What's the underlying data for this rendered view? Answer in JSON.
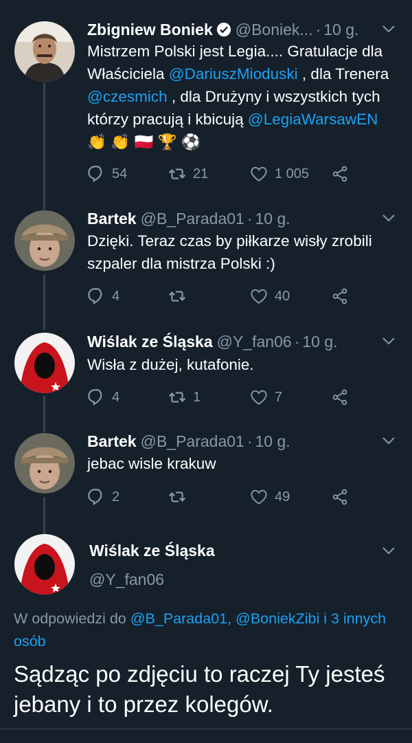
{
  "tweets": [
    {
      "name": "Zbigniew Boniek",
      "handle": "@Boniek...",
      "time": "10 g.",
      "verified": true,
      "text_parts": [
        {
          "t": "Mistrzem Polski jest Legia.... Gratulacje dla Właściciela ",
          "m": false
        },
        {
          "t": "@DariuszMioduski",
          "m": true
        },
        {
          "t": " , dla Trenera ",
          "m": false
        },
        {
          "t": "@czesmich",
          "m": true
        },
        {
          "t": " , dla Drużyny i wszystkich tych którzy pracują i kbicują ",
          "m": false
        },
        {
          "t": "@LegiaWarsawEN",
          "m": true
        },
        {
          "t": " 👏 👏 🇵🇱 🏆 ⚽",
          "m": false
        }
      ],
      "replies": "54",
      "retweets": "21",
      "likes": "1 005"
    },
    {
      "name": "Bartek",
      "handle": "@B_Parada01",
      "time": "10 g.",
      "text": "Dzięki. Teraz czas by piłkarze wisły zrobili szpaler dla mistrza Polski :)",
      "replies": "4",
      "retweets": "",
      "likes": "40"
    },
    {
      "name": "Wiślak ze Śląska",
      "handle": "@Y_fan06",
      "time": "10 g.",
      "text": "Wisła z dużej, kutafonie.",
      "replies": "4",
      "retweets": "1",
      "likes": "7"
    },
    {
      "name": "Bartek",
      "handle": "@B_Parada01",
      "time": "10 g.",
      "text": "jebac wisle krakuw",
      "replies": "2",
      "retweets": "",
      "likes": "49"
    }
  ],
  "focus": {
    "name": "Wiślak ze Śląska",
    "handle": "@Y_fan06",
    "reply_prefix": "W odpowiedzi do ",
    "reply_targets": "@B_Parada01, @BoniekZibi i 3 innych osób",
    "text": "Sądząc po zdjęciu to raczej Ty jesteś jebany i to przez kolegów."
  },
  "icons": {
    "reply": "reply-icon",
    "retweet": "retweet-icon",
    "like": "heart-icon",
    "share": "share-icon",
    "caret": "chevron-down-icon",
    "verified": "verified-badge-icon"
  },
  "colors": {
    "background": "#15202b",
    "text": "#ffffff",
    "muted": "#8899a6",
    "link": "#1da1f2",
    "divider": "#38444d"
  }
}
